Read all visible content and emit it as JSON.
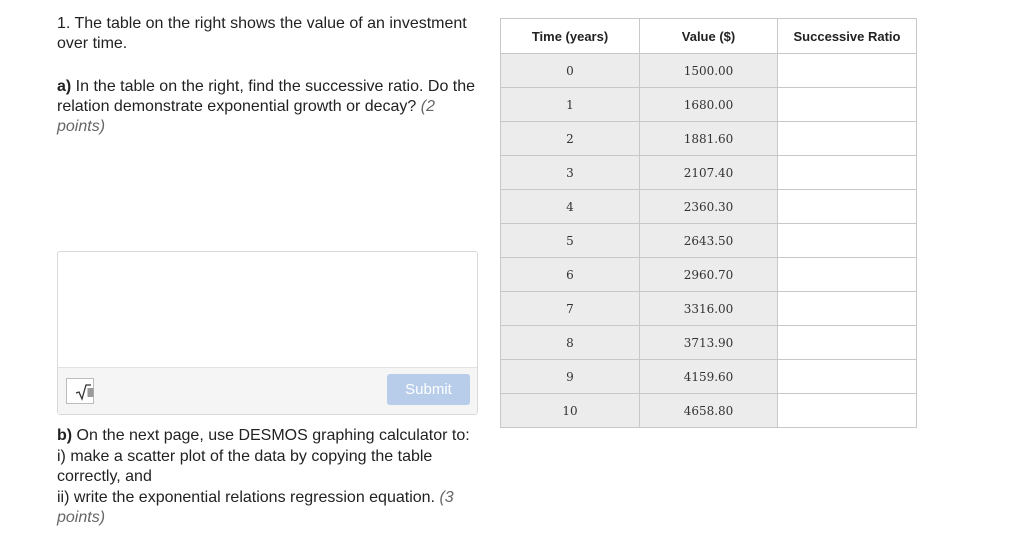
{
  "question": {
    "intro": "1. The table on the right shows the value of an investment over time.",
    "part_a_label": "a)",
    "part_a_text": " In the table on the right, find the successive ratio. Do the relation demonstrate exponential growth or decay? ",
    "part_a_points": "(2 points)",
    "part_b_label": "b)",
    "part_b_text": " On the next page, use DESMOS graphing calculator to:",
    "part_b_i": "i) make a scatter plot of the data by copying the table correctly, and",
    "part_b_ii": "ii) write the exponential relations regression equation. ",
    "part_b_points": "(3 points)"
  },
  "answer": {
    "value": "",
    "math_button_symbol": "√",
    "submit_label": "Submit"
  },
  "table": {
    "headers": [
      "Time (years)",
      "Value ($)",
      "Successive Ratio"
    ],
    "rows": [
      {
        "time": "0",
        "value": "1500.00",
        "ratio": ""
      },
      {
        "time": "1",
        "value": "1680.00",
        "ratio": ""
      },
      {
        "time": "2",
        "value": "1881.60",
        "ratio": ""
      },
      {
        "time": "3",
        "value": "2107.40",
        "ratio": ""
      },
      {
        "time": "4",
        "value": "2360.30",
        "ratio": ""
      },
      {
        "time": "5",
        "value": "2643.50",
        "ratio": ""
      },
      {
        "time": "6",
        "value": "2960.70",
        "ratio": ""
      },
      {
        "time": "7",
        "value": "3316.00",
        "ratio": ""
      },
      {
        "time": "8",
        "value": "3713.90",
        "ratio": ""
      },
      {
        "time": "9",
        "value": "4159.60",
        "ratio": ""
      },
      {
        "time": "10",
        "value": "4658.80",
        "ratio": ""
      }
    ]
  },
  "colors": {
    "submit_bg": "#b7cdea",
    "shaded_cell": "#ececec",
    "grid": "#c8c8c8"
  }
}
